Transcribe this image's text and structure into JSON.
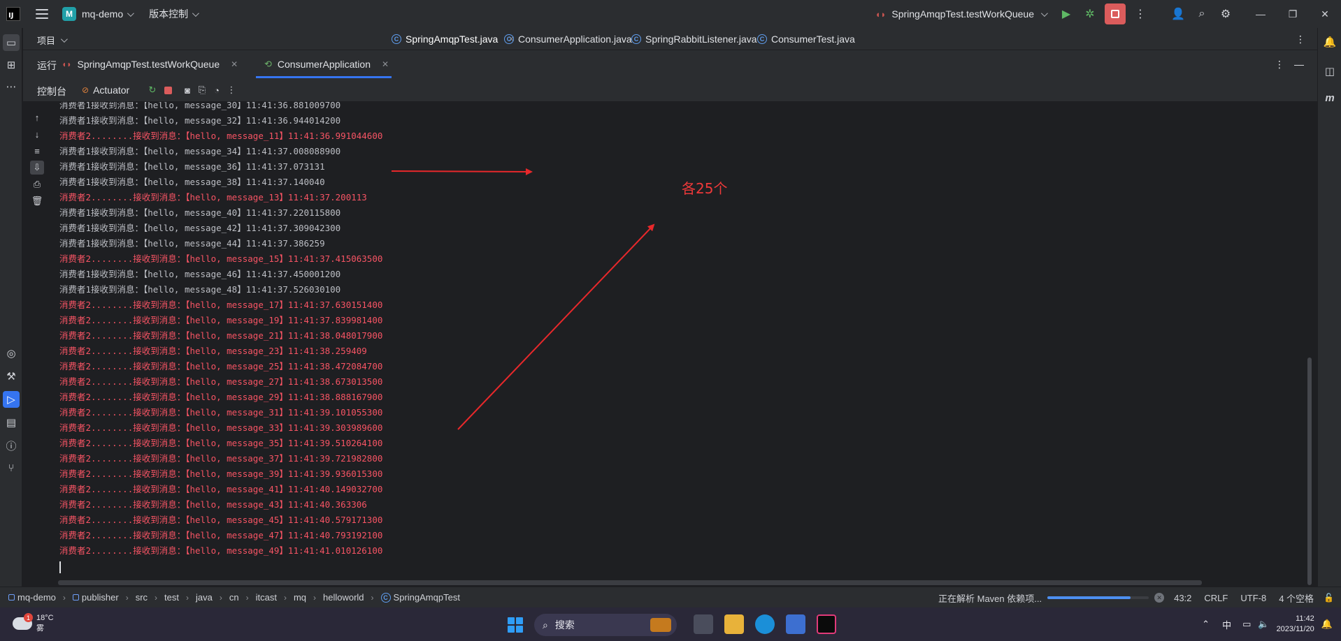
{
  "title_bar": {
    "project_badge": "M",
    "project_name": "mq-demo",
    "vcs_label": "版本控制",
    "run_config": "SpringAmqpTest.testWorkQueue",
    "window_controls": [
      "minimize-icon",
      "restore-icon",
      "close-icon"
    ]
  },
  "editor": {
    "project_label": "项目",
    "tabs": [
      {
        "label": "SpringAmqpTest.java",
        "active": true
      },
      {
        "label": "ConsumerApplication.java",
        "active": false
      },
      {
        "label": "SpringRabbitListener.java",
        "active": false
      },
      {
        "label": "ConsumerTest.java",
        "active": false
      }
    ]
  },
  "run_panel": {
    "title": "运行",
    "tabs": [
      {
        "label": "SpringAmqpTest.testWorkQueue"
      },
      {
        "label": "ConsumerApplication",
        "active": true
      }
    ],
    "console_tab": "控制台",
    "actuator_tab": "Actuator"
  },
  "console": {
    "lines": [
      {
        "text": "消费者1接收到消息：【hello, message_30】11:41:36.881009700",
        "red": false
      },
      {
        "text": "消费者1接收到消息：【hello, message_32】11:41:36.944014200",
        "red": false
      },
      {
        "text": "消费者2........接收到消息：【hello, message_11】11:41:36.991044600",
        "red": true
      },
      {
        "text": "消费者1接收到消息：【hello, message_34】11:41:37.008088900",
        "red": false
      },
      {
        "text": "消费者1接收到消息：【hello, message_36】11:41:37.073131",
        "red": false
      },
      {
        "text": "消费者1接收到消息：【hello, message_38】11:41:37.140040",
        "red": false
      },
      {
        "text": "消费者2........接收到消息：【hello, message_13】11:41:37.200113",
        "red": true
      },
      {
        "text": "消费者1接收到消息：【hello, message_40】11:41:37.220115800",
        "red": false
      },
      {
        "text": "消费者1接收到消息：【hello, message_42】11:41:37.309042300",
        "red": false
      },
      {
        "text": "消费者1接收到消息：【hello, message_44】11:41:37.386259",
        "red": false
      },
      {
        "text": "消费者2........接收到消息：【hello, message_15】11:41:37.415063500",
        "red": true
      },
      {
        "text": "消费者1接收到消息：【hello, message_46】11:41:37.450001200",
        "red": false
      },
      {
        "text": "消费者1接收到消息：【hello, message_48】11:41:37.526030100",
        "red": false
      },
      {
        "text": "消费者2........接收到消息：【hello, message_17】11:41:37.630151400",
        "red": true
      },
      {
        "text": "消费者2........接收到消息：【hello, message_19】11:41:37.839981400",
        "red": true
      },
      {
        "text": "消费者2........接收到消息：【hello, message_21】11:41:38.048017900",
        "red": true
      },
      {
        "text": "消费者2........接收到消息：【hello, message_23】11:41:38.259409",
        "red": true
      },
      {
        "text": "消费者2........接收到消息：【hello, message_25】11:41:38.472084700",
        "red": true
      },
      {
        "text": "消费者2........接收到消息：【hello, message_27】11:41:38.673013500",
        "red": true
      },
      {
        "text": "消费者2........接收到消息：【hello, message_29】11:41:38.888167900",
        "red": true
      },
      {
        "text": "消费者2........接收到消息：【hello, message_31】11:41:39.101055300",
        "red": true
      },
      {
        "text": "消费者2........接收到消息：【hello, message_33】11:41:39.303989600",
        "red": true
      },
      {
        "text": "消费者2........接收到消息：【hello, message_35】11:41:39.510264100",
        "red": true
      },
      {
        "text": "消费者2........接收到消息：【hello, message_37】11:41:39.721982800",
        "red": true
      },
      {
        "text": "消费者2........接收到消息：【hello, message_39】11:41:39.936015300",
        "red": true
      },
      {
        "text": "消费者2........接收到消息：【hello, message_41】11:41:40.149032700",
        "red": true
      },
      {
        "text": "消费者2........接收到消息：【hello, message_43】11:41:40.363306",
        "red": true
      },
      {
        "text": "消费者2........接收到消息：【hello, message_45】11:41:40.579171300",
        "red": true
      },
      {
        "text": "消费者2........接收到消息：【hello, message_47】11:41:40.793192100",
        "red": true
      },
      {
        "text": "消费者2........接收到消息：【hello, message_49】11:41:41.010126100",
        "red": true
      }
    ]
  },
  "annotation": {
    "text": "各25个",
    "color": "#f0393a"
  },
  "status_bar": {
    "breadcrumbs": [
      "mq-demo",
      "publisher",
      "src",
      "test",
      "java",
      "cn",
      "itcast",
      "mq",
      "helloworld",
      "SpringAmqpTest"
    ],
    "task": "正在解析 Maven 依赖项...",
    "position": "43:2",
    "line_sep": "CRLF",
    "encoding": "UTF-8",
    "indent": "4 个空格"
  },
  "taskbar": {
    "weather_badge": "1",
    "temperature": "18°C",
    "weather": "雾",
    "search_placeholder": "搜索",
    "ime": "中",
    "time": "11:42",
    "date": "2023/11/20"
  },
  "colors": {
    "accent": "#3574f0",
    "error_text": "#f75464",
    "stop": "#db5c5c"
  }
}
